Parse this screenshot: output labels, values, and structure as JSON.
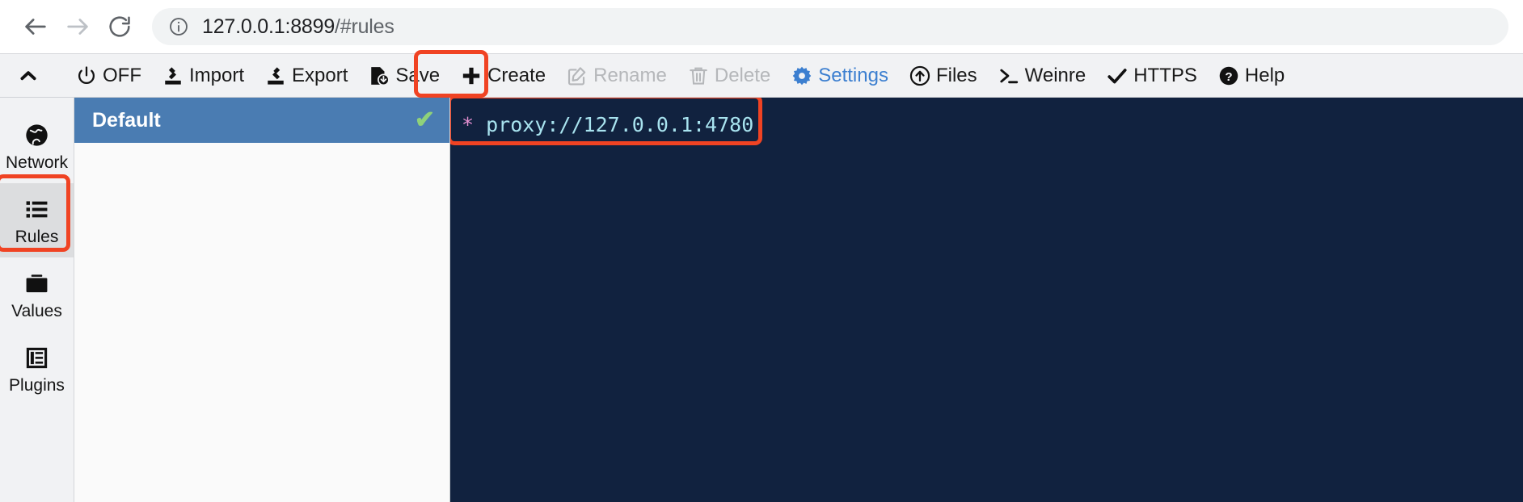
{
  "browser": {
    "back_label": "Back",
    "forward_label": "Forward",
    "reload_label": "Reload",
    "site_info_label": "View site information",
    "url_main": "127.0.0.1:8899",
    "url_fragment": "/#rules",
    "url_full": "127.0.0.1:8899/#rules"
  },
  "toolbar": {
    "items": [
      {
        "label": "",
        "icon": "chevron-up-icon",
        "name": "collapse-toolbar-button",
        "state": "normal"
      },
      {
        "label": "OFF",
        "icon": "power-icon",
        "name": "power-off-button",
        "state": "normal"
      },
      {
        "label": "Import",
        "icon": "import-icon",
        "name": "import-button",
        "state": "normal"
      },
      {
        "label": "Export",
        "icon": "export-icon",
        "name": "export-button",
        "state": "normal"
      },
      {
        "label": "Save",
        "icon": "save-icon",
        "name": "save-button",
        "state": "normal"
      },
      {
        "label": "Create",
        "icon": "plus-icon",
        "name": "create-button",
        "state": "normal"
      },
      {
        "label": "Rename",
        "icon": "edit-icon",
        "name": "rename-button",
        "state": "disabled"
      },
      {
        "label": "Delete",
        "icon": "trash-icon",
        "name": "delete-button",
        "state": "disabled"
      },
      {
        "label": "Settings",
        "icon": "gear-icon",
        "name": "settings-button",
        "state": "accent"
      },
      {
        "label": "Files",
        "icon": "upload-circle-icon",
        "name": "files-button",
        "state": "normal"
      },
      {
        "label": "Weinre",
        "icon": "terminal-icon",
        "name": "weinre-button",
        "state": "normal"
      },
      {
        "label": "HTTPS",
        "icon": "check-icon",
        "name": "https-button",
        "state": "normal"
      },
      {
        "label": "Help",
        "icon": "question-circle-icon",
        "name": "help-button",
        "state": "normal"
      }
    ]
  },
  "sidebar": {
    "items": [
      {
        "label": "Network",
        "icon": "globe-icon",
        "active": false
      },
      {
        "label": "Rules",
        "icon": "list-icon",
        "active": true
      },
      {
        "label": "Values",
        "icon": "folder-icon",
        "active": false
      },
      {
        "label": "Plugins",
        "icon": "plugins-icon",
        "active": false
      }
    ]
  },
  "rules_list": {
    "rows": [
      {
        "name": "Default",
        "selected": true,
        "enabled_mark": "✔"
      }
    ]
  },
  "editor": {
    "lines": [
      {
        "star": "*",
        "text": "proxy://127.0.0.1:4780"
      }
    ],
    "full_text": "* proxy://127.0.0.1:4780"
  },
  "highlights": {
    "color": "#f04323",
    "targets": [
      "save-button",
      "sidebar-item-rules",
      "editor-line-1"
    ]
  }
}
